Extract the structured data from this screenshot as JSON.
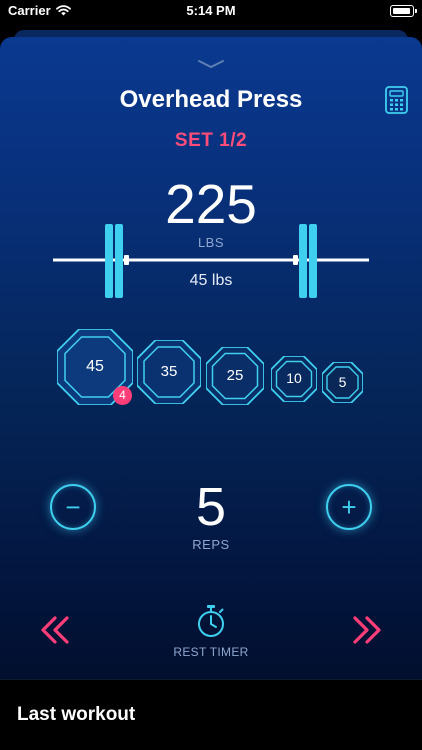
{
  "status_bar": {
    "carrier": "Carrier",
    "time": "5:14 PM",
    "battery_level": 0.9
  },
  "exercise": {
    "title": "Overhead Press",
    "set_label": "SET 1/2",
    "weight": "225",
    "weight_unit": "LBS",
    "bar_weight": "45 lbs"
  },
  "plates": [
    {
      "value": "45",
      "count": "4"
    },
    {
      "value": "35"
    },
    {
      "value": "25"
    },
    {
      "value": "10"
    },
    {
      "value": "5"
    }
  ],
  "reps": {
    "value": "5",
    "label": "REPS",
    "minus": "−",
    "plus": "+"
  },
  "rest_timer": {
    "label": "REST TIMER"
  },
  "last_workout": {
    "title": "Last workout"
  },
  "colors": {
    "accent": "#3fd0f0",
    "highlight": "#ff4d7a",
    "badge": "#ff3d78"
  },
  "icons": [
    "wifi-icon",
    "battery-icon",
    "chevron-down-icon",
    "calculator-icon",
    "barbell-icon",
    "stopwatch-icon",
    "chevron-double-left-icon",
    "chevron-double-right-icon"
  ]
}
